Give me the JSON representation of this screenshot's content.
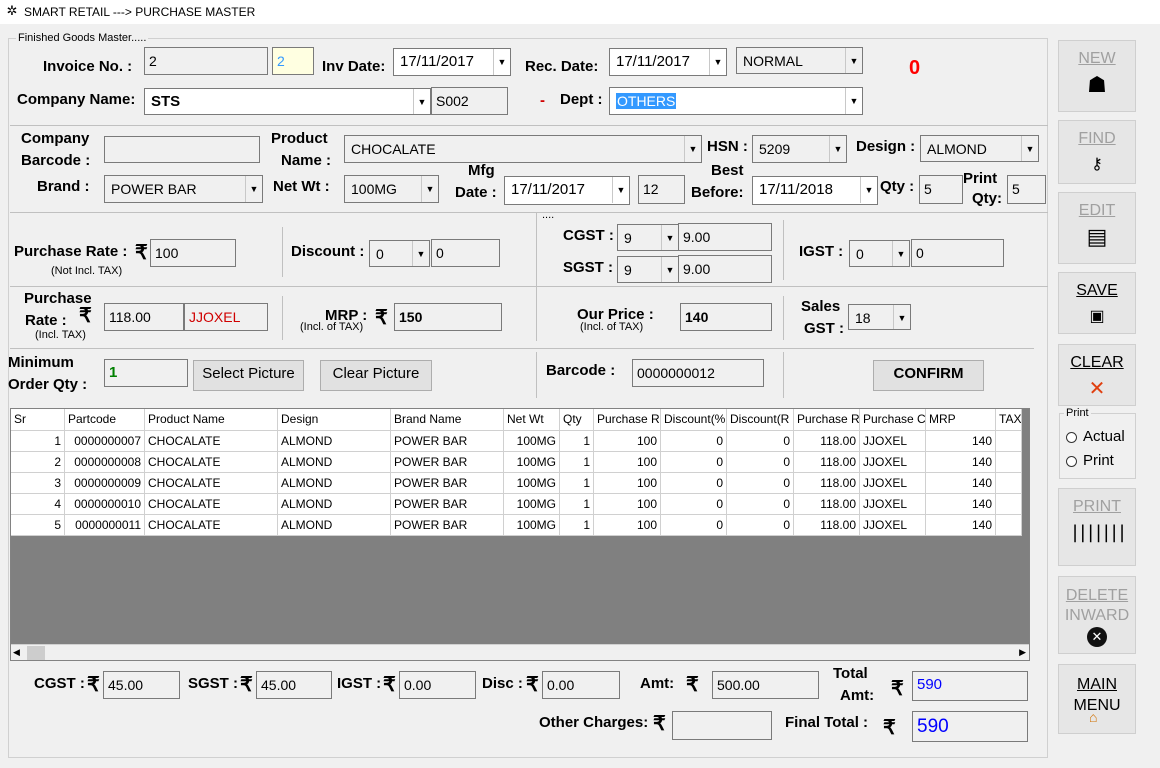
{
  "window": {
    "title": "SMART RETAIL ---> PURCHASE MASTER"
  },
  "group_title": "Finished Goods Master.....",
  "invoice": {
    "label": "Invoice No. :",
    "value": "2",
    "seq": "2",
    "inv_date_label": "Inv Date:",
    "inv_date": "17/11/2017",
    "rec_date_label": "Rec. Date:",
    "rec_date": "17/11/2017",
    "type": "NORMAL",
    "counter": "0"
  },
  "company": {
    "label": "Company Name:",
    "value": "STS",
    "code": "S002",
    "dash": "-",
    "dept_label": "Dept :",
    "dept": "OTHERS"
  },
  "product": {
    "company_barcode_label1": "Company",
    "company_barcode_label2": "Barcode :",
    "company_barcode": "",
    "product_name_label1": "Product",
    "product_name_label2": "Name :",
    "product_name": "CHOCALATE",
    "hsn_label": "HSN :",
    "hsn": "5209",
    "design_label": "Design :",
    "design": "ALMOND",
    "brand_label": "Brand :",
    "brand": "POWER BAR",
    "net_wt_label": "Net Wt :",
    "net_wt": "100MG",
    "mfg_label1": "Mfg",
    "mfg_label2": "Date :",
    "mfg_date": "17/11/2017",
    "months": "12",
    "best_label1": "Best",
    "best_label2": "Before:",
    "best_before": "17/11/2018",
    "qty_label": "Qty :",
    "qty": "5",
    "print_qty_label1": "Print",
    "print_qty_label2": "Qty:",
    "print_qty": "5"
  },
  "pricing": {
    "purchase_rate_label": "Purchase Rate :",
    "purchase_rate": "100",
    "purchase_rate_note": "(Not Incl. TAX)",
    "discount_label": "Discount :",
    "discount_type": "0",
    "discount_value": "0",
    "cgst_label": "CGST :",
    "cgst_rate": "9",
    "cgst_value": "9.00",
    "sgst_label": "SGST :",
    "sgst_rate": "9",
    "sgst_value": "9.00",
    "igst_label": "IGST :",
    "igst_rate": "0",
    "igst_value": "0",
    "purchase_incl_label1": "Purchase",
    "purchase_incl_label2": "Rate :",
    "purchase_incl_note": "(Incl. TAX)",
    "purchase_incl": "118.00",
    "purchase_code": "JJOXEL",
    "mrp_label": "MRP :",
    "mrp_note": "(Incl. of TAX)",
    "mrp": "150",
    "our_price_label": "Our Price :",
    "our_price_note": "(Incl. of TAX)",
    "our_price": "140",
    "sales_gst_label1": "Sales",
    "sales_gst_label2": "GST :",
    "sales_gst": "18",
    "min_order_label1": "Minimum",
    "min_order_label2": "Order Qty :",
    "min_order": "1",
    "select_picture": "Select Picture",
    "clear_picture": "Clear Picture",
    "barcode_label": "Barcode :",
    "barcode": "0000000012",
    "confirm": "CONFIRM"
  },
  "grid": {
    "columns": [
      "Sr",
      "Partcode",
      "Product Name",
      "Design",
      "Brand Name",
      "Net Wt",
      "Qty",
      "Purchase R",
      "Discount(%",
      "Discount(R",
      "Purchase R",
      "Purchase C",
      "MRP",
      "TAX"
    ],
    "rows": [
      [
        "1",
        "0000000007",
        "CHOCALATE",
        "ALMOND",
        "POWER BAR",
        "100MG",
        "1",
        "100",
        "0",
        "0",
        "118.00",
        "JJOXEL",
        "140",
        ""
      ],
      [
        "2",
        "0000000008",
        "CHOCALATE",
        "ALMOND",
        "POWER BAR",
        "100MG",
        "1",
        "100",
        "0",
        "0",
        "118.00",
        "JJOXEL",
        "140",
        ""
      ],
      [
        "3",
        "0000000009",
        "CHOCALATE",
        "ALMOND",
        "POWER BAR",
        "100MG",
        "1",
        "100",
        "0",
        "0",
        "118.00",
        "JJOXEL",
        "140",
        ""
      ],
      [
        "4",
        "0000000010",
        "CHOCALATE",
        "ALMOND",
        "POWER BAR",
        "100MG",
        "1",
        "100",
        "0",
        "0",
        "118.00",
        "JJOXEL",
        "140",
        ""
      ],
      [
        "5",
        "0000000011",
        "CHOCALATE",
        "ALMOND",
        "POWER BAR",
        "100MG",
        "1",
        "100",
        "0",
        "0",
        "118.00",
        "JJOXEL",
        "140",
        ""
      ]
    ]
  },
  "totals": {
    "cgst_label": "CGST :",
    "cgst": "45.00",
    "sgst_label": "SGST :",
    "sgst": "45.00",
    "igst_label": "IGST :",
    "igst": "0.00",
    "disc_label": "Disc :",
    "disc": "0.00",
    "amt_label": "Amt:",
    "amt": "500.00",
    "total_amt_label1": "Total",
    "total_amt_label2": "Amt:",
    "total_amt": "590",
    "other_charges_label": "Other Charges:",
    "other_charges": "",
    "final_total_label": "Final Total :",
    "final_total": "590",
    "rupee": "₹"
  },
  "sidebar": {
    "new": "NEW",
    "find": "FIND",
    "edit": "EDIT",
    "save": "SAVE",
    "clear": "CLEAR",
    "print_group": "Print",
    "actual": "Actual",
    "print_option": "Print",
    "print": "PRINT",
    "delete1": "DELETE",
    "delete2": "INWARD",
    "main1": "MAIN",
    "main2": "MENU"
  },
  "colors": {
    "counter": "#ff0000",
    "selection": "#3399ff",
    "blue_text": "#0000ff",
    "red_text": "#d00000",
    "green_text": "#008000"
  }
}
